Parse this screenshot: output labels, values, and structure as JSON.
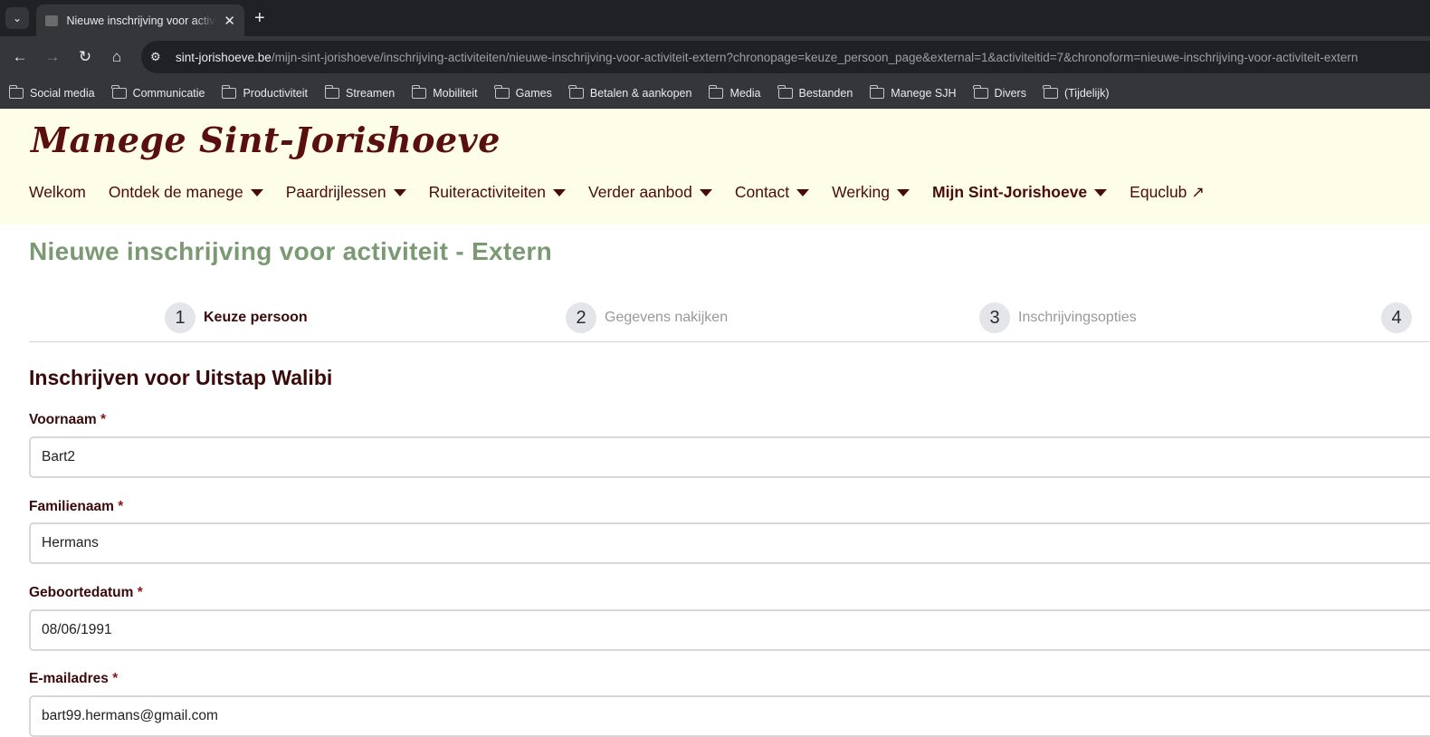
{
  "browser": {
    "tab_title": "Nieuwe inschrijving voor activiteit - Extern",
    "url_host": "sint-jorishoeve.be",
    "url_path": "/mijn-sint-jorishoeve/inschrijving-activiteiten/nieuwe-inschrijving-voor-activiteit-extern?chronopage=keuze_persoon_page&external=1&activiteitid=7&chronoform=nieuwe-inschrijving-voor-activiteit-extern",
    "bookmarks": [
      "Social media",
      "Communicatie",
      "Productiviteit",
      "Streamen",
      "Mobiliteit",
      "Games",
      "Betalen & aankopen",
      "Media",
      "Bestanden",
      "Manege SJH",
      "Divers",
      "(Tijdelijk)"
    ]
  },
  "site": {
    "logo": "Manege Sint-Jorishoeve",
    "nav": [
      {
        "label": "Welkom"
      },
      {
        "label": "Ontdek de manege"
      },
      {
        "label": "Paardrijlessen"
      },
      {
        "label": "Ruiteractiviteiten"
      },
      {
        "label": "Verder aanbod"
      },
      {
        "label": "Contact"
      },
      {
        "label": "Werking"
      },
      {
        "label": "Mijn Sint-Jorishoeve"
      },
      {
        "label": "Equclub ↗"
      }
    ]
  },
  "page": {
    "title": "Nieuwe inschrijving voor activiteit - Extern",
    "steps": [
      {
        "num": "1",
        "label": "Keuze persoon"
      },
      {
        "num": "2",
        "label": "Gegevens nakijken"
      },
      {
        "num": "3",
        "label": "Inschrijvingsopties"
      },
      {
        "num": "4",
        "label": ""
      }
    ],
    "form_title": "Inschrijven voor Uitstap Walibi",
    "required_mark": "*",
    "fields": [
      {
        "label": "Voornaam",
        "value": "Bart2"
      },
      {
        "label": "Familienaam",
        "value": "Hermans"
      },
      {
        "label": "Geboortedatum",
        "value": "08/06/1991"
      },
      {
        "label": "E-mailadres",
        "value": "bart99.hermans@gmail.com"
      }
    ]
  }
}
